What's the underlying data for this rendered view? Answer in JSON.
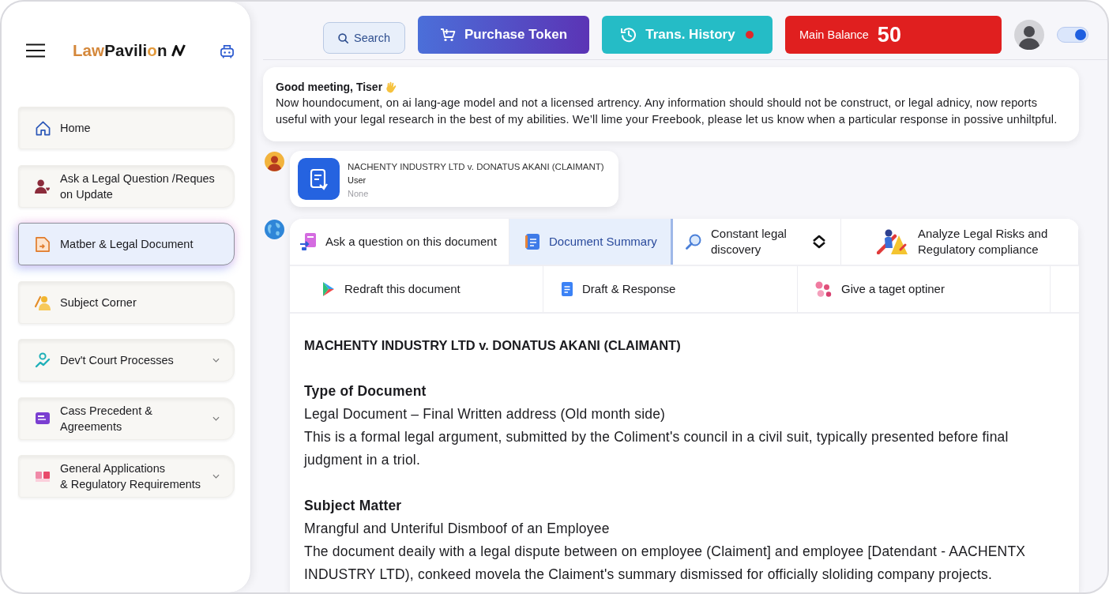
{
  "sidebar": {
    "logo": {
      "segments": [
        {
          "text": "Law",
          "color": "#d4873a"
        },
        {
          "text": "Pavili",
          "color": "#1a1a1a"
        },
        {
          "text": "o",
          "color": "#e39a3c"
        },
        {
          "text": "n",
          "color": "#1a1a1a"
        }
      ]
    },
    "nav_items": [
      {
        "label": "Home",
        "kind": "link",
        "selected": false
      },
      {
        "label": "Ask a Legal Question /Reques\non Update",
        "kind": "link",
        "selected": false
      },
      {
        "label": "Matber & Legal Document",
        "kind": "link",
        "selected": true
      },
      {
        "label": "Subject Corner",
        "kind": "link",
        "selected": false
      },
      {
        "label": "Dev't Court Processes",
        "kind": "dropdown",
        "selected": false
      },
      {
        "label": "Cass Precedent &\nAgreements",
        "kind": "dropdown",
        "selected": false
      },
      {
        "label": "General Applications\n& Regulatory Requirements",
        "kind": "dropdown",
        "selected": false
      }
    ]
  },
  "top_bar": {
    "search": {
      "label": "Search"
    },
    "purchase_button": {
      "label": "Purchase Token"
    },
    "history_button": {
      "label": "Trans. History",
      "notification": true
    },
    "balance": {
      "label": "Main Balance",
      "value": "50"
    },
    "theme_toggle": {
      "on": true
    }
  },
  "greeting": {
    "title": "Good meeting, Tiser",
    "text": "Now houndocument, on ai lang-age model and not a licensed artrency. Any information should should not be construct, or legal adnicy, now reports useful with your legal research in the best of my abilities. We’ll lime your Freebook, please let us know when a particular response in possive unhiltpful."
  },
  "user_message": {
    "title": "NACHENTY INDUSTRY LTD v. DONATUS AKANI (CLAIMANT)",
    "sender": "User",
    "status": "None"
  },
  "response": {
    "action_rows": [
      [
        {
          "label": "Ask a question on this document",
          "selected": false
        },
        {
          "label": "Document Summary",
          "selected": true
        },
        {
          "label": "Constant legal\ndiscovery",
          "selected": false
        },
        {
          "label": "Analyze Legal Risks and\nRegulatory compliance",
          "selected": false
        }
      ],
      [
        {
          "label": "Redraft this document",
          "selected": false
        },
        {
          "label": "Draft & Response",
          "selected": false
        },
        {
          "label": "Give a taget optiner",
          "selected": false
        }
      ]
    ],
    "document": {
      "title": "MACHENTY INDUSTRY LTD v. DONATUS AKANI (CLAIMANT)",
      "sections": [
        {
          "heading": "Type of Document",
          "lines": [
            "Legal Document – Final Written address (Old month side)",
            "This is a formal legal argument, submitted by the Coliment's council in a civil suit, typically presented before final judgment in a triol."
          ]
        },
        {
          "heading": "Subject Matter",
          "lines": [
            "Mrangful and Unteriful Dismboof of an Employee",
            "The document deaily with a legal dispute between on employee (Claiment] and employee [Datendant - AACHENTX INDUSTRY LTD), conkeed movela the Claiment's summary dismissed for officially sloliding company projects."
          ]
        }
      ]
    }
  }
}
